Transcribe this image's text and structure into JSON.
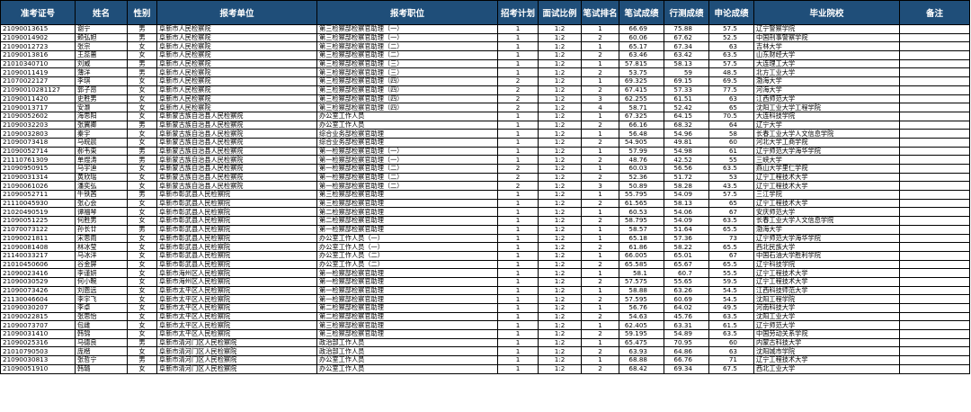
{
  "headers": [
    "准考证号",
    "姓名",
    "性别",
    "报考单位",
    "报考职位",
    "招考计划",
    "面试比例",
    "笔试排名",
    "笔试成绩",
    "行测成绩",
    "申论成绩",
    "毕业院校",
    "备注"
  ],
  "rows": [
    [
      "21090013615",
      "谢宁",
      "男",
      "阜新市人民检察院",
      "第三检察部检察官助理（一）",
      "1",
      "1:2",
      "1",
      "66.69",
      "75.88",
      "57.5",
      "辽宁警察学院",
      ""
    ],
    [
      "21090014902",
      "赖弘妲",
      "男",
      "阜新市人民检察院",
      "第三检察部检察官助理（一）",
      "1",
      "1:2",
      "2",
      "60.06",
      "67.62",
      "52.5",
      "中国刑事警察学院",
      ""
    ],
    [
      "21090012723",
      "张宗",
      "女",
      "阜新市人民检察院",
      "第三检察部检察官助理（二）",
      "1",
      "1:2",
      "1",
      "65.17",
      "67.34",
      "63",
      "吉林大学",
      ""
    ],
    [
      "21090013816",
      "王蕊蕙",
      "女",
      "阜新市人民检察院",
      "第三检察部检察官助理（二）",
      "1",
      "1:2",
      "2",
      "63.46",
      "63.42",
      "63.5",
      "山东财经大学",
      ""
    ],
    [
      "21010340710",
      "刘威",
      "男",
      "阜新市人民检察院",
      "第三检察部检察官助理（三）",
      "1",
      "1:2",
      "1",
      "57.815",
      "58.13",
      "57.5",
      "大连理工大学",
      ""
    ],
    [
      "21090011419",
      "薄洋",
      "男",
      "阜新市人民检察院",
      "第三检察部检察官助理（三）",
      "1",
      "1:2",
      "2",
      "53.75",
      "59",
      "48.5",
      "北方工业大学",
      ""
    ],
    [
      "21070022127",
      "李琪",
      "女",
      "阜新市人民检察院",
      "第三检察部检察官助理（四）",
      "2",
      "1:2",
      "1",
      "69.325",
      "69.15",
      "69.5",
      "渤海大学",
      ""
    ],
    [
      "21090010281127",
      "郭子昂",
      "女",
      "阜新市人民检察院",
      "第三检察部检察官助理（四）",
      "2",
      "1:2",
      "2",
      "67.415",
      "57.33",
      "77.5",
      "河海大学",
      ""
    ],
    [
      "21090011420",
      "史胜男",
      "女",
      "阜新市人民检察院",
      "第三检察部检察官助理（四）",
      "2",
      "1:2",
      "3",
      "62.255",
      "61.51",
      "63",
      "江西师范大学",
      ""
    ],
    [
      "21090013717",
      "安灏",
      "女",
      "阜新市人民检察院",
      "第三检察部检察官助理（四）",
      "2",
      "1:2",
      "4",
      "58.71",
      "52.42",
      "65",
      "沈阳工业大学工程学院",
      ""
    ],
    [
      "21090052602",
      "海思阳",
      "女",
      "阜新蒙古族自治县人民检察院",
      "办公室工作人员",
      "1",
      "1:2",
      "1",
      "67.325",
      "64.15",
      "70.5",
      "大连科技学院",
      ""
    ],
    [
      "21090032203",
      "张翼卿",
      "男",
      "阜新蒙古族自治县人民检察院",
      "办公室工作人员",
      "1",
      "1:2",
      "2",
      "66.16",
      "68.32",
      "64",
      "辽宁大学",
      ""
    ],
    [
      "21090032803",
      "秦宇",
      "女",
      "阜新蒙古族自治县人民检察院",
      "综合业务部检察官助理",
      "1",
      "1:2",
      "1",
      "56.48",
      "54.96",
      "58",
      "长春工业大学人文信息学院",
      ""
    ],
    [
      "21090073418",
      "马皖晨",
      "女",
      "阜新蒙古族自治县人民检察院",
      "综合业务部检察官助理",
      "1",
      "1:2",
      "2",
      "54.905",
      "49.81",
      "60",
      "河北大学工商学院",
      ""
    ],
    [
      "21090052714",
      "郝韦東",
      "男",
      "阜新蒙古族自治县人民检察院",
      "第一检察部检察官助理（一）",
      "1",
      "1:2",
      "1",
      "57.99",
      "54.98",
      "61",
      "辽宁师范大学海华学院",
      ""
    ],
    [
      "21110761309",
      "单煜涛",
      "男",
      "阜新蒙古族自治县人民检察院",
      "第一检察部检察官助理（一）",
      "1",
      "1:2",
      "2",
      "48.76",
      "42.52",
      "55",
      "三峡大学",
      ""
    ],
    [
      "21090950915",
      "马宇迪",
      "女",
      "阜新蒙古族自治县人民检察院",
      "第一检察部检察官助理（二）",
      "2",
      "1:2",
      "1",
      "60.03",
      "56.56",
      "63.5",
      "燕山大学里仁学院",
      ""
    ],
    [
      "21090031314",
      "黄欣瑶",
      "女",
      "阜新蒙古族自治县人民检察院",
      "第一检察部检察官助理（二）",
      "2",
      "1:2",
      "2",
      "52.36",
      "51.72",
      "53",
      "辽宁工程技术大学",
      ""
    ],
    [
      "21090061026",
      "潘奕弘",
      "女",
      "阜新蒙古族自治县人民检察院",
      "第一检察部检察官助理（二）",
      "2",
      "1:2",
      "3",
      "50.89",
      "58.28",
      "43.5",
      "辽宁工程技术大学",
      ""
    ],
    [
      "21090052711",
      "牛铁茜",
      "男",
      "阜新市彰武县人民检察院",
      "第三检察部检察官助理",
      "1",
      "1:2",
      "1",
      "55.795",
      "54.09",
      "57.5",
      "三江学院",
      ""
    ],
    [
      "21110045930",
      "张心会",
      "女",
      "阜新市彰武县人民检察院",
      "第三检察部检察官助理",
      "1",
      "1:2",
      "2",
      "61.565",
      "58.13",
      "65",
      "辽宁工程技术大学",
      ""
    ],
    [
      "21020490519",
      "谭福琴",
      "女",
      "阜新市彰武县人民检察院",
      "第二检察部检察官助理",
      "1",
      "1:2",
      "1",
      "60.53",
      "54.06",
      "67",
      "安庆师范大学",
      ""
    ],
    [
      "21090051225",
      "何胜男",
      "女",
      "阜新市彰武县人民检察院",
      "第二检察部检察官助理",
      "1",
      "1:2",
      "2",
      "58.795",
      "54.09",
      "63.5",
      "长春工业大学人文信息学院",
      ""
    ],
    [
      "21070073122",
      "孙长廿",
      "男",
      "阜新市彰武县人民检察院",
      "第一检察部检察官助理",
      "1",
      "1:2",
      "1",
      "58.57",
      "51.64",
      "65.5",
      "渤海大学",
      ""
    ],
    [
      "21090021811",
      "宋思雨",
      "女",
      "阜新市彰武县人民检察院",
      "办公室工作人员（一）",
      "1",
      "1:2",
      "1",
      "65.18",
      "57.36",
      "73",
      "辽宁师范大学海华学院",
      ""
    ],
    [
      "21090081408",
      "林冰莹",
      "女",
      "阜新市彰武县人民检察院",
      "办公室工作人员（一）",
      "1",
      "1:2",
      "2",
      "61.86",
      "58.22",
      "65.5",
      "西北民族大学",
      ""
    ],
    [
      "21140033217",
      "马冰洋",
      "女",
      "阜新市彰武县人民检察院",
      "办公室工作人员（二）",
      "1",
      "1:2",
      "1",
      "66.005",
      "65.01",
      "67",
      "中国石油大学胜利学院",
      ""
    ],
    [
      "21010450606",
      "谷金屏",
      "女",
      "阜新市彰武县人民检察院",
      "办公室工作人员（二）",
      "1",
      "1:2",
      "2",
      "65.585",
      "65.67",
      "65.5",
      "辽宁科技学院",
      ""
    ],
    [
      "21090023416",
      "李谨妍",
      "女",
      "阜新市海州区人民检察院",
      "第一检察部检察官助理",
      "1",
      "1:2",
      "1",
      "58.1",
      "60.7",
      "55.5",
      "辽宁工程技术大学",
      ""
    ],
    [
      "21090030529",
      "何小畹",
      "女",
      "阜新市海州区人民检察院",
      "第一检察部检察官助理",
      "1",
      "1:2",
      "2",
      "57.575",
      "55.65",
      "59.5",
      "辽宁工程技术大学",
      ""
    ],
    [
      "21090073426",
      "刘恩远",
      "女",
      "阜新市太平区人民检察院",
      "第一检察部检察官助理",
      "1",
      "1:2",
      "1",
      "58.88",
      "63.26",
      "54.5",
      "江西科技师范大学",
      ""
    ],
    [
      "21130046604",
      "李宇飞",
      "女",
      "阜新市太平区人民检察院",
      "第一检察部检察官助理",
      "1",
      "1:2",
      "2",
      "57.595",
      "60.69",
      "54.5",
      "沈阳工程学院",
      ""
    ],
    [
      "21090030207",
      "李卓",
      "女",
      "阜新市太平区人民检察院",
      "第二检察部检察官助理",
      "1",
      "1:2",
      "1",
      "56.76",
      "64.02",
      "49.5",
      "河南科技大学",
      ""
    ],
    [
      "21090022815",
      "张思怡",
      "女",
      "阜新市太平区人民检察院",
      "第二检察部检察官助理",
      "1",
      "1:2",
      "2",
      "54.63",
      "45.76",
      "63.5",
      "沈阳工业大学",
      ""
    ],
    [
      "21090073707",
      "包雌",
      "女",
      "阜新市太平区人民检察院",
      "第三检察部检察官助理",
      "1",
      "1:2",
      "1",
      "62.405",
      "63.31",
      "61.5",
      "辽宁师范大学",
      ""
    ],
    [
      "21090031410",
      "韩锦",
      "女",
      "阜新市太平区人民检察院",
      "第三检察部检察官助理",
      "1",
      "1:2",
      "2",
      "59.195",
      "54.89",
      "63.5",
      "中国劳动关系学院",
      ""
    ],
    [
      "21090025316",
      "马德良",
      "男",
      "阜新市清河门区人民检察院",
      "政治部工作人员",
      "1",
      "1:2",
      "1",
      "65.475",
      "70.95",
      "60",
      "内蒙古科技大学",
      ""
    ],
    [
      "21010790503",
      "庞楷",
      "女",
      "阜新市清河门区人民检察院",
      "政治部工作人员",
      "1",
      "1:2",
      "2",
      "63.93",
      "64.86",
      "63",
      "沈阳城市学院",
      ""
    ],
    [
      "21090030813",
      "张哲宁",
      "男",
      "阜新市清河门区人民检察院",
      "办公室工作人员",
      "1",
      "1:2",
      "1",
      "68.88",
      "66.76",
      "71",
      "辽宁工程技术大学",
      ""
    ],
    [
      "21090051910",
      "韩璐",
      "女",
      "阜新市清河门区人民检察院",
      "办公室工作人员",
      "1",
      "1:2",
      "2",
      "68.42",
      "69.34",
      "67.5",
      "西北工业大学",
      ""
    ]
  ]
}
